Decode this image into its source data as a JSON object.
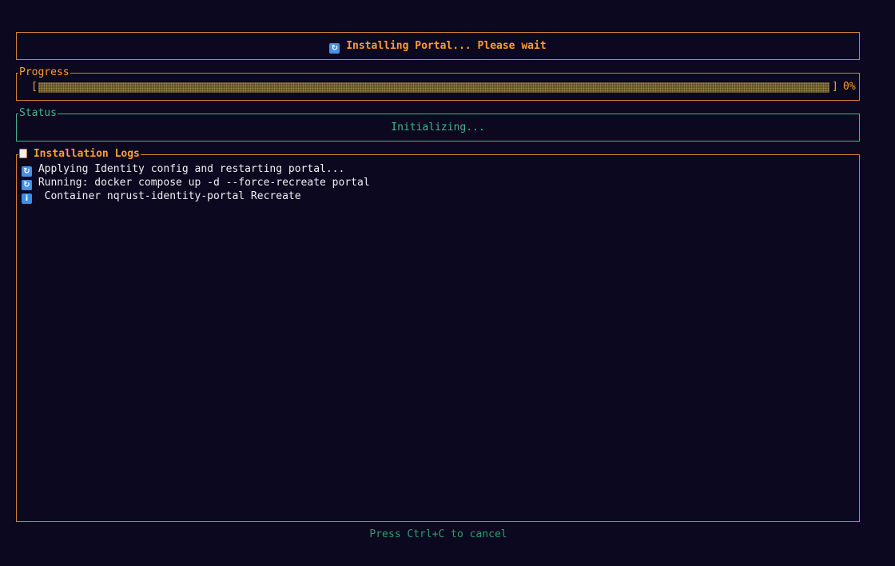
{
  "header": {
    "icon": "refresh-icon",
    "title": "Installing Portal... Please wait"
  },
  "progress": {
    "label": "Progress",
    "open_bracket": "[",
    "close_bracket": "]",
    "percent_text": "0%",
    "value": 0
  },
  "status": {
    "label": "Status",
    "text": "Initializing..."
  },
  "logs": {
    "icon": "clipboard-icon",
    "label": "Installation Logs",
    "entries": [
      {
        "icon": "refresh-icon",
        "text": "Applying Identity config and restarting portal..."
      },
      {
        "icon": "refresh-icon",
        "text": "Running: docker compose up -d --force-recreate portal"
      },
      {
        "icon": "info-icon",
        "text": " Container nqrust-identity-portal Recreate"
      }
    ]
  },
  "footer": {
    "hint": "Press Ctrl+C to cancel"
  },
  "colors": {
    "background": "#0b0820",
    "accent_orange": "#ff9f2e",
    "border_orange": "#d7812b",
    "accent_green": "#3fb887",
    "icon_blue": "#4a90e2"
  }
}
